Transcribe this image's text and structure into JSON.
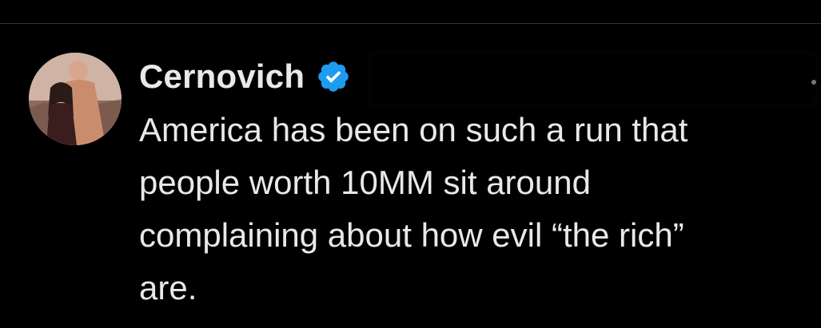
{
  "tweet": {
    "author_name": "Cernovich",
    "verified_icon": "verified-badge-icon",
    "text": "America has been on such a run that\npeople worth 10MM sit around\ncomplaining about how evil “the rich”\nare."
  },
  "colors": {
    "background": "#000000",
    "text": "#e7e9ea",
    "verified_blue": "#1d9bf0",
    "divider": "#2f3336"
  }
}
